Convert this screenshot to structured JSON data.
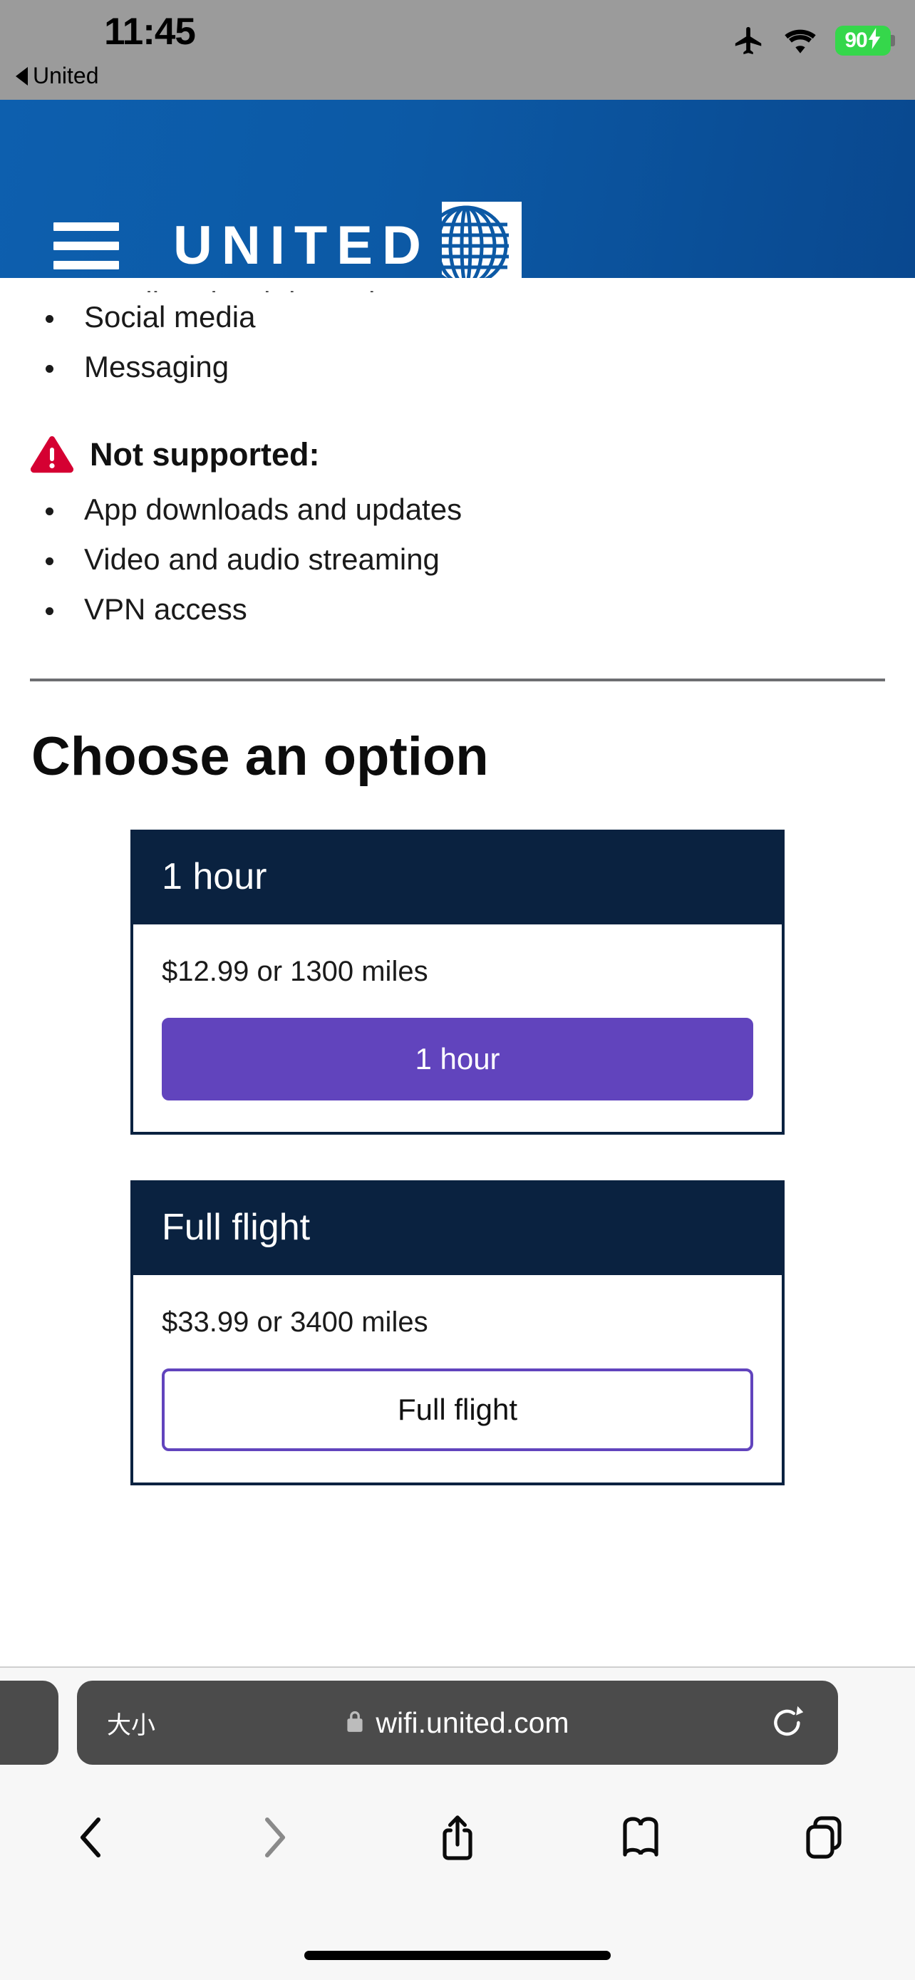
{
  "status_bar": {
    "time": "11:45",
    "back_app_label": "United",
    "back_arrow_icon": "triangle-left-icon",
    "airplane_mode_icon": "airplane-icon",
    "wifi_icon": "wifi-icon",
    "battery_percent": "90",
    "battery_charging_icon": "lightning-bolt-icon",
    "battery_color": "#35d74b",
    "bar_color": "#9b9b9b"
  },
  "site_header": {
    "menu_icon": "hamburger-menu-icon",
    "brand_wordmark": "UNITED",
    "globe_logo_icon": "united-globe-logo-icon",
    "registered_mark": "®",
    "background_from": "#0d5fae",
    "background_to": "#09488f"
  },
  "main": {
    "supported_bullets": [
      "Email and web browsing",
      "Social media",
      "Messaging"
    ],
    "not_supported": {
      "warning_icon": "warning-triangle-icon",
      "warning_color": "#d50032",
      "heading": "Not supported:",
      "bullets": [
        "App downloads and updates",
        "Video and audio streaming",
        "VPN access"
      ]
    },
    "choose_title": "Choose an option",
    "cards": [
      {
        "title": "1 hour",
        "price": "$12.99 or 1300 miles",
        "button_label": "1 hour",
        "button_style": "filled"
      },
      {
        "title": "Full flight",
        "price": "$33.99 or 3400 miles",
        "button_label": "Full flight",
        "button_style": "outline"
      }
    ],
    "card_header_color": "#0a2240",
    "accent_purple": "#6144bd"
  },
  "browser": {
    "text_size_label": "大小",
    "lock_icon": "lock-icon",
    "url": "wifi.united.com",
    "reload_icon": "reload-icon",
    "toolbar": {
      "back_icon": "chevron-left-icon",
      "forward_icon": "chevron-right-icon",
      "share_icon": "share-icon",
      "bookmarks_icon": "book-icon",
      "tabs_icon": "tabs-icon"
    },
    "bar_color": "#4b4b4b",
    "chrome_color": "#f7f7f7"
  }
}
